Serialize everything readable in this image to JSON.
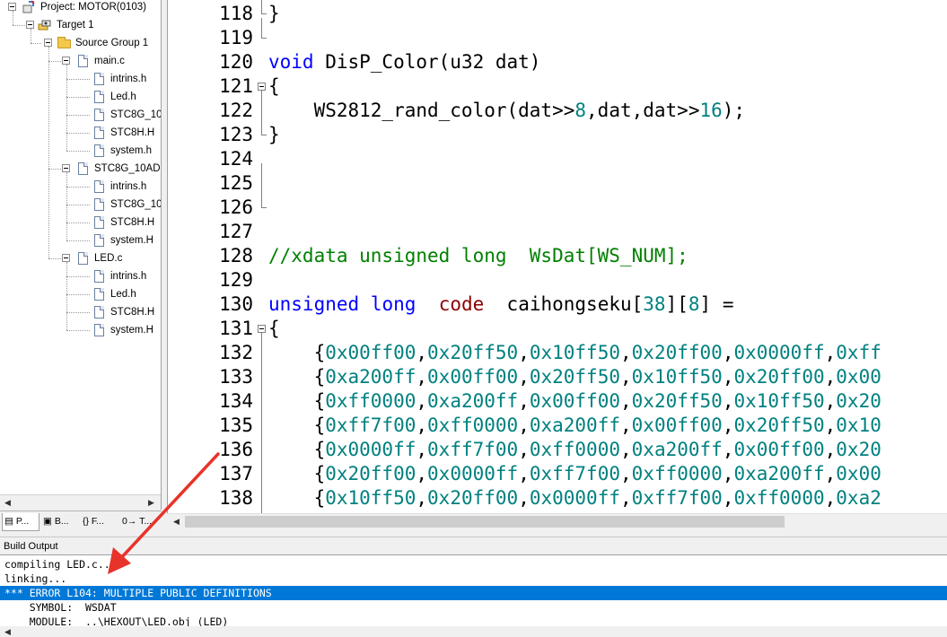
{
  "project_tree": {
    "project": "Project: MOTOR(0103)",
    "target": "Target 1",
    "group": "Source Group 1",
    "files": [
      {
        "name": "main.c",
        "includes": [
          "intrins.h",
          "Led.h",
          "STC8G_10",
          "STC8H.H",
          "system.h"
        ]
      },
      {
        "name": "STC8G_10AD.",
        "includes": [
          "intrins.h",
          "STC8G_10",
          "STC8H.H",
          "system.H"
        ]
      },
      {
        "name": "LED.c",
        "includes": [
          "intrins.h",
          "Led.h",
          "STC8H.H",
          "system.H"
        ]
      }
    ]
  },
  "panel_tabs": [
    "P...",
    "B...",
    "{} F...",
    "0→ T..."
  ],
  "editor": {
    "lines": [
      {
        "n": "118",
        "code": "}"
      },
      {
        "n": "119",
        "code": ""
      },
      {
        "n": "120",
        "code": "void DisP_Color(u32 dat)"
      },
      {
        "n": "121",
        "code": "{"
      },
      {
        "n": "122",
        "code": "    WS2812_rand_color(dat>>8,dat,dat>>16);"
      },
      {
        "n": "123",
        "code": "}"
      },
      {
        "n": "124",
        "code": ""
      },
      {
        "n": "125",
        "code": ""
      },
      {
        "n": "126",
        "code": ""
      },
      {
        "n": "127",
        "code": ""
      },
      {
        "n": "128",
        "code": "//xdata unsigned long  WsDat[WS_NUM];"
      },
      {
        "n": "129",
        "code": ""
      },
      {
        "n": "130",
        "code": "unsigned long  code  caihongseku[38][8] ="
      },
      {
        "n": "131",
        "code": "{"
      },
      {
        "n": "132",
        "code": "    {0x00ff00,0x20ff50,0x10ff50,0x20ff00,0x0000ff,0xff"
      },
      {
        "n": "133",
        "code": "    {0xa200ff,0x00ff00,0x20ff50,0x10ff50,0x20ff00,0x00"
      },
      {
        "n": "134",
        "code": "    {0xff0000,0xa200ff,0x00ff00,0x20ff50,0x10ff50,0x20"
      },
      {
        "n": "135",
        "code": "    {0xff7f00,0xff0000,0xa200ff,0x00ff00,0x20ff50,0x10"
      },
      {
        "n": "136",
        "code": "    {0x0000ff,0xff7f00,0xff0000,0xa200ff,0x00ff00,0x20"
      },
      {
        "n": "137",
        "code": "    {0x20ff00,0x0000ff,0xff7f00,0xff0000,0xa200ff,0x00"
      },
      {
        "n": "138",
        "code": "    {0x10ff50,0x20ff00,0x0000ff,0xff7f00,0xff0000,0xa2"
      }
    ]
  },
  "build_output": {
    "title": "Build Output",
    "lines": [
      "compiling LED.c...",
      "linking...",
      "*** ERROR L104: MULTIPLE PUBLIC DEFINITIONS",
      "    SYMBOL:  WSDAT",
      "    MODULE:  ..\\HEXOUT\\LED.obj (LED)"
    ],
    "selected_line": 2
  },
  "colors": {
    "keyword": "#0000ff",
    "keyword_code": "#8b0000",
    "comment": "#008000",
    "number": "#008080",
    "selection": "#0078d7",
    "annotation_arrow": "#e8332a"
  },
  "icons": [
    "project-icon",
    "target-icon",
    "folder-icon",
    "file-icon",
    "scroll-left-icon",
    "scroll-right-icon"
  ]
}
